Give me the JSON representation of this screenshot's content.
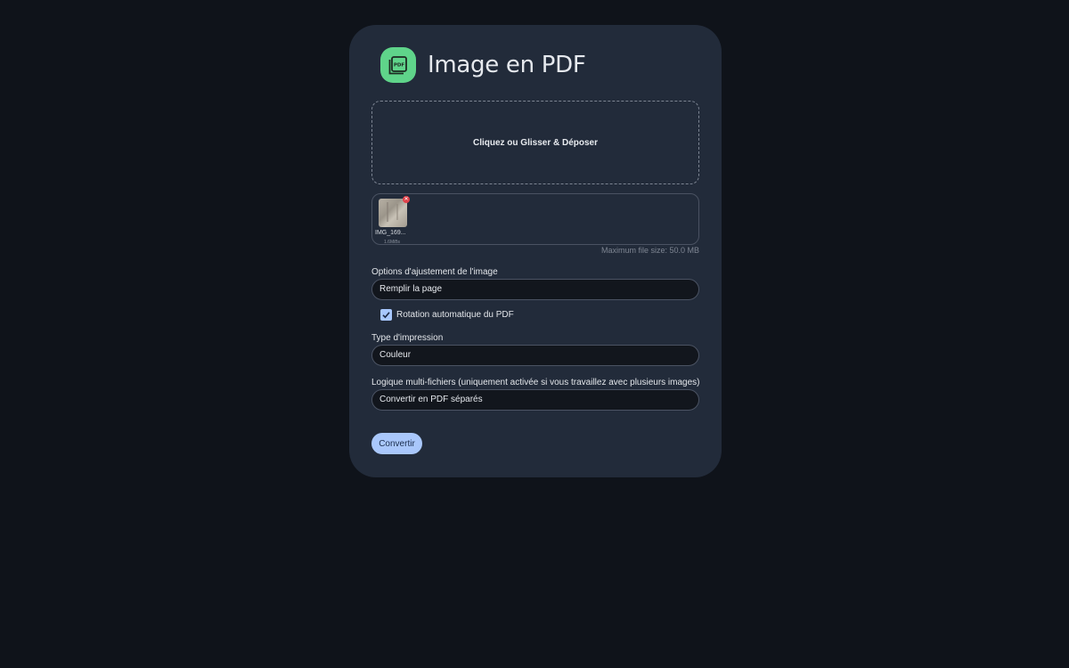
{
  "app": {
    "title": "Image en PDF",
    "icon": "pdf-stack-icon",
    "accent_color": "#5fd48a"
  },
  "dropzone": {
    "label": "Cliquez ou Glisser & Déposer"
  },
  "files": [
    {
      "name": "IMG_169...",
      "size": "1.6MiBs",
      "remove_icon": "close-icon"
    }
  ],
  "max_file_size": "Maximum file size: 50.0 MB",
  "fit_options": {
    "label": "Options d'ajustement de l'image",
    "value": "Remplir la page"
  },
  "auto_rotate": {
    "label": "Rotation automatique du PDF",
    "checked": true
  },
  "print_type": {
    "label": "Type d'impression",
    "value": "Couleur"
  },
  "multi_file": {
    "label": "Logique multi-fichiers (uniquement activée si vous travaillez avec plusieurs images)",
    "value": "Convertir en PDF séparés"
  },
  "convert_button": {
    "label": "Convertir",
    "color": "#a9c7fb"
  }
}
